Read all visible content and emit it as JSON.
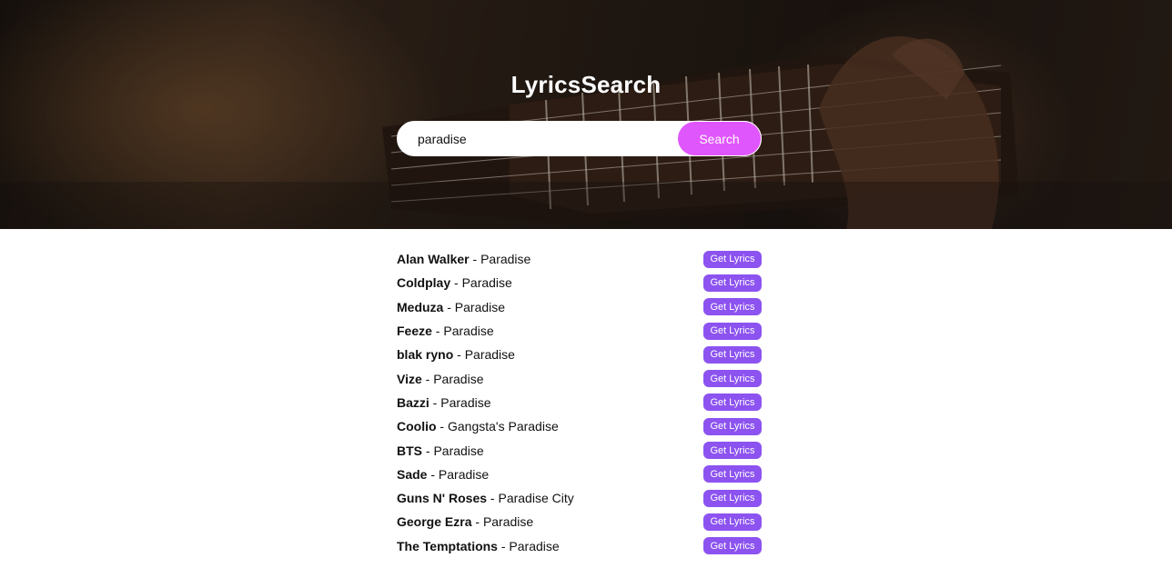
{
  "app": {
    "title": "LyricsSearch"
  },
  "search": {
    "value": "paradise",
    "button_label": "Search"
  },
  "results": {
    "button_label": "Get Lyrics",
    "separator": " - ",
    "items": [
      {
        "artist": "Alan Walker",
        "song": "Paradise"
      },
      {
        "artist": "Coldplay",
        "song": "Paradise"
      },
      {
        "artist": "Meduza",
        "song": "Paradise"
      },
      {
        "artist": "Feeze",
        "song": "Paradise"
      },
      {
        "artist": "blak ryno",
        "song": "Paradise"
      },
      {
        "artist": "Vize",
        "song": "Paradise"
      },
      {
        "artist": "Bazzi",
        "song": "Paradise"
      },
      {
        "artist": "Coolio",
        "song": "Gangsta's Paradise"
      },
      {
        "artist": "BTS",
        "song": "Paradise"
      },
      {
        "artist": "Sade",
        "song": "Paradise"
      },
      {
        "artist": "Guns N' Roses",
        "song": "Paradise City"
      },
      {
        "artist": "George Ezra",
        "song": "Paradise"
      },
      {
        "artist": "The Temptations",
        "song": "Paradise"
      }
    ]
  },
  "colors": {
    "search_button": "#e056fd",
    "get_lyrics_button": "#8c53f0"
  }
}
